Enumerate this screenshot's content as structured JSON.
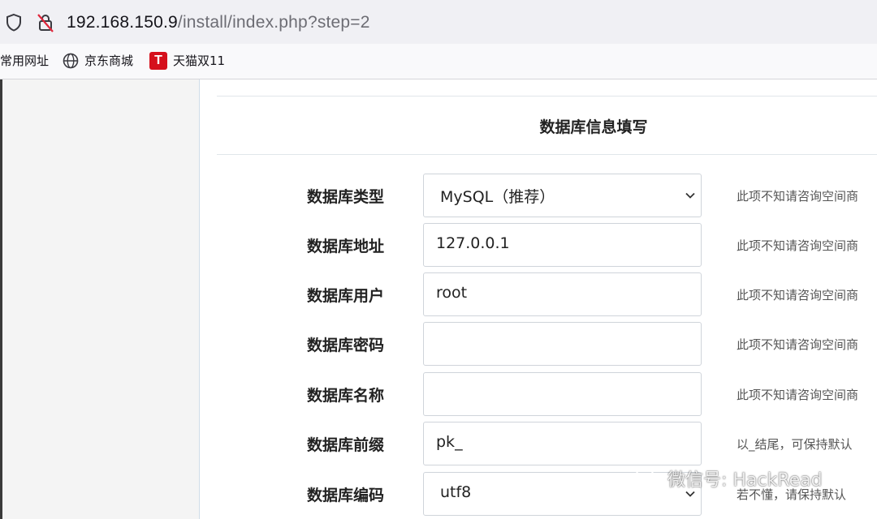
{
  "browser": {
    "url_host": "192.168.150.9",
    "url_path": "/install/index.php?step=2"
  },
  "bookmarks": [
    {
      "label": "常用网址",
      "icon": "none"
    },
    {
      "label": "京东商城",
      "icon": "globe-icon"
    },
    {
      "label": "天猫双11",
      "icon": "tmall-icon",
      "icon_text": "T",
      "icon_color": "#d5101c"
    }
  ],
  "form": {
    "title": "数据库信息填写",
    "fields": [
      {
        "label": "数据库类型",
        "value": "MySQL（推荐）",
        "kind": "select",
        "hint": "此项不知请咨询空间商"
      },
      {
        "label": "数据库地址",
        "value": "127.0.0.1",
        "kind": "text",
        "hint": "此项不知请咨询空间商"
      },
      {
        "label": "数据库用户",
        "value": "root",
        "kind": "text",
        "hint": "此项不知请咨询空间商"
      },
      {
        "label": "数据库密码",
        "value": "",
        "kind": "password",
        "hint": "此项不知请咨询空间商"
      },
      {
        "label": "数据库名称",
        "value": "",
        "kind": "text",
        "hint": "此项不知请咨询空间商"
      },
      {
        "label": "数据库前缀",
        "value": "pk_",
        "kind": "text",
        "hint": "以_结尾，可保持默认"
      },
      {
        "label": "数据库编码",
        "value": "utf8",
        "kind": "select",
        "hint": "若不懂，请保持默认"
      }
    ]
  },
  "watermark": {
    "text": "微信号: HackRead"
  }
}
